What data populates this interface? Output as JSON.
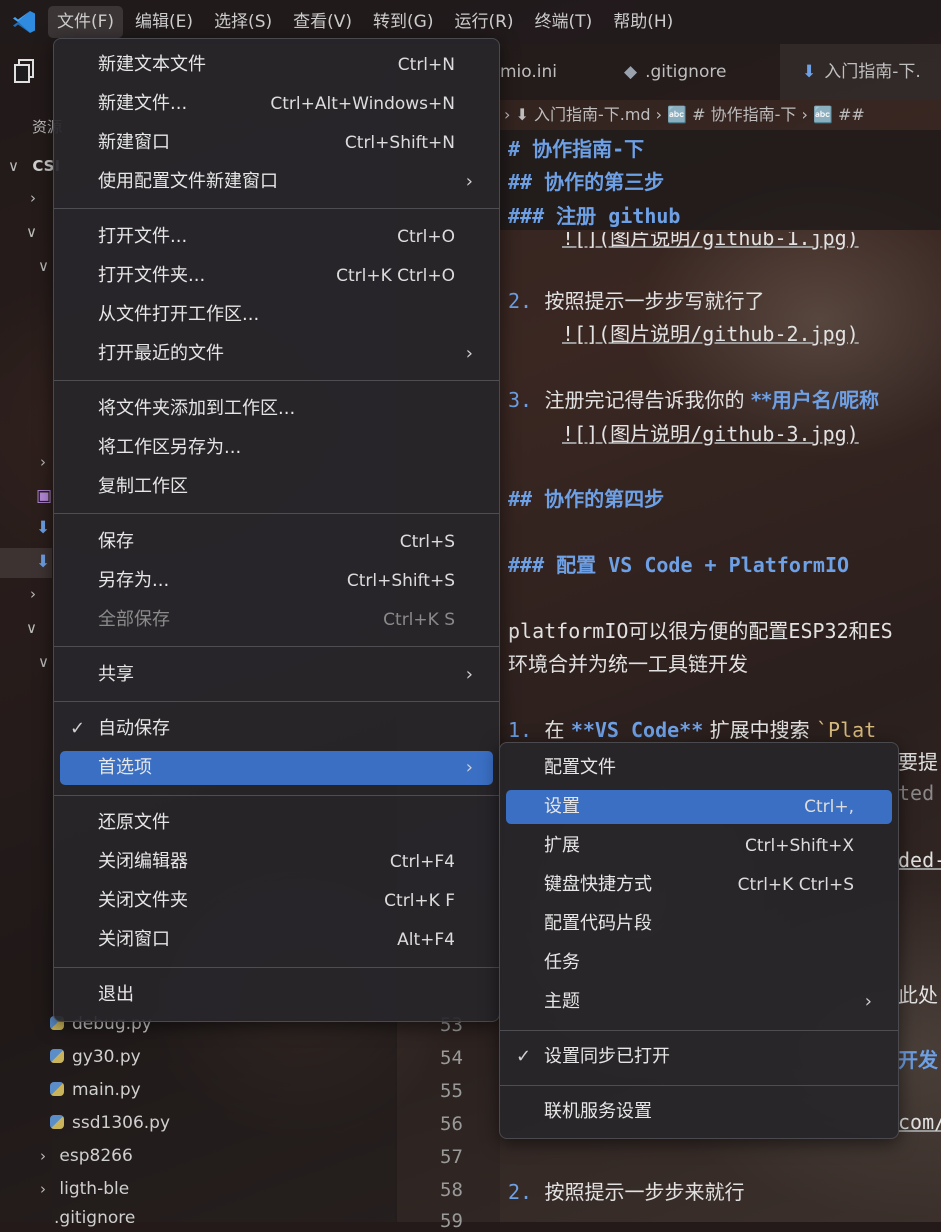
{
  "menubar": {
    "items": [
      "文件(F)",
      "编辑(E)",
      "选择(S)",
      "查看(V)",
      "转到(G)",
      "运行(R)",
      "终端(T)",
      "帮助(H)"
    ]
  },
  "sidebar": {
    "title": "资源",
    "root": "CSI",
    "files": [
      "debug.py",
      "gy30.py",
      "main.py",
      "ssd1306.py"
    ],
    "folders": [
      "esp8266",
      "ligth-ble"
    ],
    "last": ".gitignore"
  },
  "line_numbers": [
    "53",
    "54",
    "55",
    "56",
    "57",
    "58",
    "59"
  ],
  "tabs": [
    {
      "label": "mio.ini",
      "icon": ""
    },
    {
      "label": ".gitignore",
      "icon": "◆"
    },
    {
      "label": "入门指南-下.",
      "icon": "⬇"
    }
  ],
  "breadcrumbs": "› ⬇ 入门指南-下.md › 🔤 # 协作指南-下 › 🔤 ##",
  "editor": {
    "sticky": [
      "# 协作指南-下",
      "## 协作的第三步",
      "### 注册 github"
    ],
    "line_img1": "![](图片说明/github-1.jpg)",
    "item2_num": "2.",
    "item2_text": "按照提示一步步写就行了",
    "item2_img": "![](图片说明/github-2.jpg)",
    "item3_num": "3.",
    "item3_text": "注册完记得告诉我你的 ",
    "item3_bold": "**用户名/昵称",
    "item3_img": "![](图片说明/github-3.jpg)",
    "h2_step4": "## 协作的第四步",
    "h3_config": "### 配置 VS Code + PlatformIO",
    "para1_a": "platformIO可以很方便的配置ESP32和ES",
    "para1_b": "环境合并为统一工具链开发",
    "item1_num": "1.",
    "item1_pre": "在 ",
    "item1_bold": "**VS Code**",
    "item1_mid": " 扩展中搜索 ",
    "item1_code": "`Plat",
    "frag1": "要提",
    "frag2": "ted",
    "frag3": "ded-",
    "frag4": "此处",
    "frag5": "开发",
    "frag6": "com/",
    "item2b_num": "2.",
    "item2b_text": "按照提示一步步来就行"
  },
  "file_menu": {
    "items": [
      {
        "label": "新建文本文件",
        "shortcut": "Ctrl+N"
      },
      {
        "label": "新建文件...",
        "shortcut": "Ctrl+Alt+Windows+N"
      },
      {
        "label": "新建窗口",
        "shortcut": "Ctrl+Shift+N"
      },
      {
        "label": "使用配置文件新建窗口",
        "shortcut": ""
      },
      {
        "label": "打开文件...",
        "shortcut": "Ctrl+O"
      },
      {
        "label": "打开文件夹...",
        "shortcut": "Ctrl+K Ctrl+O"
      },
      {
        "label": "从文件打开工作区...",
        "shortcut": ""
      },
      {
        "label": "打开最近的文件",
        "shortcut": ""
      },
      {
        "label": "将文件夹添加到工作区...",
        "shortcut": ""
      },
      {
        "label": "将工作区另存为...",
        "shortcut": ""
      },
      {
        "label": "复制工作区",
        "shortcut": ""
      },
      {
        "label": "保存",
        "shortcut": "Ctrl+S"
      },
      {
        "label": "另存为...",
        "shortcut": "Ctrl+Shift+S"
      },
      {
        "label": "全部保存",
        "shortcut": "Ctrl+K S"
      },
      {
        "label": "共享",
        "shortcut": ""
      },
      {
        "label": "自动保存",
        "shortcut": ""
      },
      {
        "label": "首选项",
        "shortcut": ""
      },
      {
        "label": "还原文件",
        "shortcut": ""
      },
      {
        "label": "关闭编辑器",
        "shortcut": "Ctrl+F4"
      },
      {
        "label": "关闭文件夹",
        "shortcut": "Ctrl+K F"
      },
      {
        "label": "关闭窗口",
        "shortcut": "Alt+F4"
      },
      {
        "label": "退出",
        "shortcut": ""
      }
    ]
  },
  "prefs_menu": {
    "items": [
      {
        "label": "配置文件",
        "shortcut": ""
      },
      {
        "label": "设置",
        "shortcut": "Ctrl+,"
      },
      {
        "label": "扩展",
        "shortcut": "Ctrl+Shift+X"
      },
      {
        "label": "键盘快捷方式",
        "shortcut": "Ctrl+K Ctrl+S"
      },
      {
        "label": "配置代码片段",
        "shortcut": ""
      },
      {
        "label": "任务",
        "shortcut": ""
      },
      {
        "label": "主题",
        "shortcut": ""
      },
      {
        "label": "设置同步已打开",
        "shortcut": ""
      },
      {
        "label": "联机服务设置",
        "shortcut": ""
      }
    ]
  },
  "colors": {
    "accent": "#3a6fc4",
    "heading": "#6ea0e6"
  }
}
